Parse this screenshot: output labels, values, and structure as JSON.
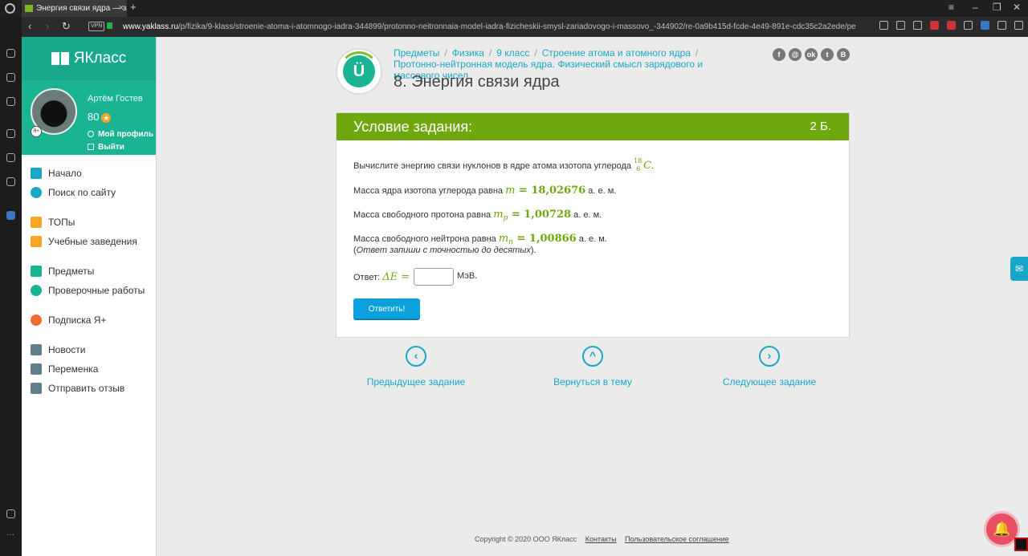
{
  "browser": {
    "tab_title": "Энергия связи ядра — за",
    "tab_close": "×",
    "new_tab": "+",
    "vpn": "VPN",
    "url_host": "www.yaklass.ru",
    "url_path": "/p/fizika/9-klass/stroenie-atoma-i-atomnogo-iadra-344899/protonno-neitronnaia-model-iadra-fizicheskii-smysl-zariadovogo-i-massovo_-344902/re-0a9b415d-fcde-4e49-891e-cdc35c2a2ede/pe"
  },
  "site": {
    "logo": "ЯКласс",
    "user_name": "Артём Гостев",
    "points": "80",
    "avatar_badge": "Я+",
    "profile_link": "Мой профиль",
    "logout_link": "Выйти"
  },
  "menu": [
    {
      "label": "Начало",
      "icon": "home-icon",
      "color": "#1aa6c9"
    },
    {
      "label": "Поиск по сайту",
      "icon": "search-icon",
      "color": "#1aa6c9"
    },
    {
      "label": "ТОПы",
      "icon": "star-icon",
      "color": "#f5a623"
    },
    {
      "label": "Учебные заведения",
      "icon": "institution-icon",
      "color": "#f5a623"
    },
    {
      "label": "Предметы",
      "icon": "books-icon",
      "color": "#1ab394"
    },
    {
      "label": "Проверочные работы",
      "icon": "check-circle-icon",
      "color": "#1ab394"
    },
    {
      "label": "Подписка Я+",
      "icon": "subscription-icon",
      "color": "#f06b2f"
    },
    {
      "label": "Новости",
      "icon": "megaphone-icon",
      "color": "#607d8b"
    },
    {
      "label": "Переменка",
      "icon": "bell-icon",
      "color": "#607d8b"
    },
    {
      "label": "Отправить отзыв",
      "icon": "feedback-icon",
      "color": "#607d8b"
    }
  ],
  "breadcrumb": [
    "Предметы",
    "Физика",
    "9 класс",
    "Строение атома и атомного ядра",
    "Протонно-нейтронная модель ядра. Физический смысл зарядового и массового чисел"
  ],
  "breadcrumb_sep": "/",
  "badge_letter": "Ü",
  "page_title": "8. Энергия связи ядра",
  "social": [
    "f",
    "@",
    "ok",
    "t",
    "B"
  ],
  "task": {
    "header": "Условие задания:",
    "points": "2 Б.",
    "line1": "Вычислите энергию связи нуклонов в ядре атома изотопа углерода",
    "iso_mass": "18",
    "iso_charge": "6",
    "iso_symbol": "C",
    "period": ".",
    "line2_text": "Масса ядра изотопа  углерода равна",
    "line2_var": "m",
    "line2_val": " = 18,02676",
    "unit": "а. е. м.",
    "line3_text": "Масса  свободного протона равна",
    "line3_var": "m",
    "line3_sub": "p",
    "line3_val": " = 1,00728",
    "line4_text": "Масса  свободного нейтрона равна",
    "line4_var": "m",
    "line4_sub": "n",
    "line4_val": " = 1,00866",
    "hint_open": "(",
    "hint": "Ответ запиши с точностью до десятых",
    "hint_close": ").",
    "answer_label": "Ответ:",
    "answer_var": "ΔE =",
    "answer_value": "",
    "answer_unit": "МэВ.",
    "submit": "Ответить!"
  },
  "nav": {
    "prev": "Предыдущее задание",
    "back": "Вернуться в тему",
    "next": "Следующее задание",
    "prev_glyph": "‹",
    "back_glyph": "^",
    "next_glyph": "›"
  },
  "footer": {
    "copyright": "Copyright © 2020 ООО ЯКласс",
    "contacts": "Контакты",
    "terms": "Пользовательское соглашение"
  },
  "floating": {
    "mail_glyph": "✉",
    "bell_glyph": "🔔"
  }
}
